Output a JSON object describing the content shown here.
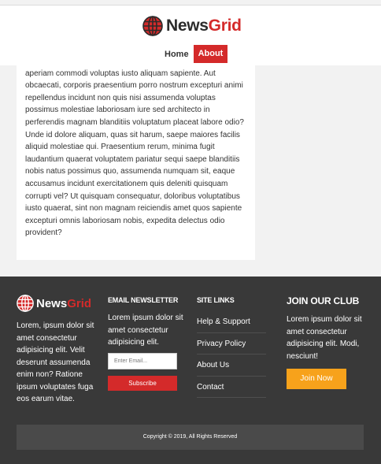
{
  "site": {
    "name_part1": "News",
    "name_part2": "Grid"
  },
  "nav": {
    "items": [
      {
        "label": "Home"
      },
      {
        "label": "About"
      }
    ]
  },
  "article": {
    "text": "iusto voluptatum suscipit et quasi. Repellendus minus, ratione aperiam commodi voluptas iusto aliquam sapiente. Aut obcaecati, corporis praesentium porro nostrum excepturi animi repellendus incidunt non quis nisi assumenda voluptas possimus molestiae laboriosam iure sed architecto in perferendis magnam blanditiis voluptatum placeat labore odio? Unde id dolore aliquam, quas sit harum, saepe maiores facilis aliquid molestiae qui. Praesentium rerum, minima fugit laudantium quaerat voluptatem pariatur sequi saepe blanditiis nobis natus possimus quo, assumenda numquam sit, eaque accusamus incidunt exercitationem quis deleniti quisquam corrupti vel? Ut quisquam consequatur, doloribus voluptatibus iusto quaerat, sint non magnam reiciendis amet quos sapiente excepturi omnis laboriosam nobis, expedita delectus odio provident?"
  },
  "footer": {
    "about_text": "Lorem, ipsum dolor sit amet consectetur adipisicing elit. Velit deserunt assumenda enim non? Ratione ipsum voluptates fuga eos earum vitae.",
    "newsletter": {
      "title": "Email Newsletter",
      "text": "Lorem ipsum dolor sit amet consectetur adipisicing elit.",
      "placeholder": "Enter Email...",
      "button": "Subscribe"
    },
    "site_links": {
      "title": "Site Links",
      "items": [
        {
          "label": "Help & Support"
        },
        {
          "label": "Privacy Policy"
        },
        {
          "label": "About Us"
        },
        {
          "label": "Contact"
        }
      ]
    },
    "club": {
      "title": "Join Our Club",
      "text": "Lorem ipsum dolor sit amet consectetur adipisicing elit. Modi, nesciunt!",
      "button": "Join Now"
    },
    "copyright": "Copyright © 2019, All Rights Reserved"
  },
  "icons": {
    "logo": "globe-icon"
  },
  "colors": {
    "brand_red": "#d42a2a",
    "accent_orange": "#f7a21b",
    "footer_bg": "#393939"
  }
}
